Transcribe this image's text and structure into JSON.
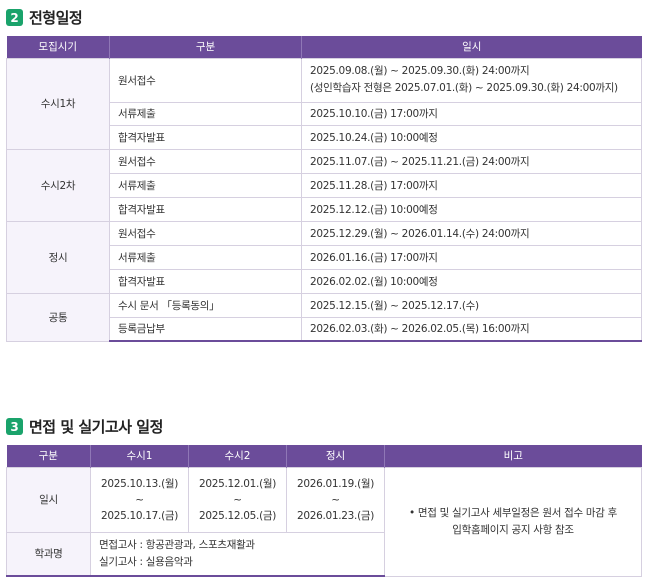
{
  "section1": {
    "number": "2",
    "title": "전형일정",
    "headers": [
      "모집시기",
      "구분",
      "일시"
    ],
    "groups": [
      {
        "name": "수시1차",
        "rows": [
          {
            "label": "원서접수",
            "value": "2025.09.08.(월) ~ 2025.09.30.(화) 24:00까지",
            "value2": "(성인학습자 전형은 2025.07.01.(화) ~ 2025.09.30.(화) 24:00까지)"
          },
          {
            "label": "서류제출",
            "value": "2025.10.10.(금) 17:00까지"
          },
          {
            "label": "합격자발표",
            "value": "2025.10.24.(금) 10:00예정"
          }
        ]
      },
      {
        "name": "수시2차",
        "rows": [
          {
            "label": "원서접수",
            "value": "2025.11.07.(금) ~ 2025.11.21.(금) 24:00까지"
          },
          {
            "label": "서류제출",
            "value": "2025.11.28.(금) 17:00까지"
          },
          {
            "label": "합격자발표",
            "value": "2025.12.12.(금) 10:00예정"
          }
        ]
      },
      {
        "name": "정시",
        "rows": [
          {
            "label": "원서접수",
            "value": "2025.12.29.(월) ~ 2026.01.14.(수) 24:00까지"
          },
          {
            "label": "서류제출",
            "value": "2026.01.16.(금) 17:00까지"
          },
          {
            "label": "합격자발표",
            "value": "2026.02.02.(월) 10:00예정"
          }
        ]
      },
      {
        "name": "공통",
        "rows": [
          {
            "label": "수시 문서 「등록동의」",
            "value": "2025.12.15.(월) ~ 2025.12.17.(수)"
          },
          {
            "label": "등록금납부",
            "value": "2026.02.03.(화) ~ 2026.02.05.(목) 16:00까지"
          }
        ]
      }
    ]
  },
  "section2": {
    "number": "3",
    "title": "면접 및 실기고사 일정",
    "headers": [
      "구분",
      "수시1",
      "수시2",
      "정시",
      "비고"
    ],
    "schedule_label": "일시",
    "sushi1": {
      "start": "2025.10.13.(월)",
      "tilde": "~",
      "end": "2025.10.17.(금)"
    },
    "sushi2": {
      "start": "2025.12.01.(월)",
      "tilde": "~",
      "end": "2025.12.05.(금)"
    },
    "jeongsi": {
      "start": "2026.01.19.(월)",
      "tilde": "~",
      "end": "2026.01.23.(금)"
    },
    "note_line1": "• 면접 및 실기고사 세부일정은 원서 접수 마감 후",
    "note_line2": "입학홈페이지 공지 사항 참조",
    "dept_label": "학과명",
    "dept_line1": "면접고사 : 항공관광과, 스포츠재활과",
    "dept_line2": "실기고사 : 실용음악과"
  }
}
